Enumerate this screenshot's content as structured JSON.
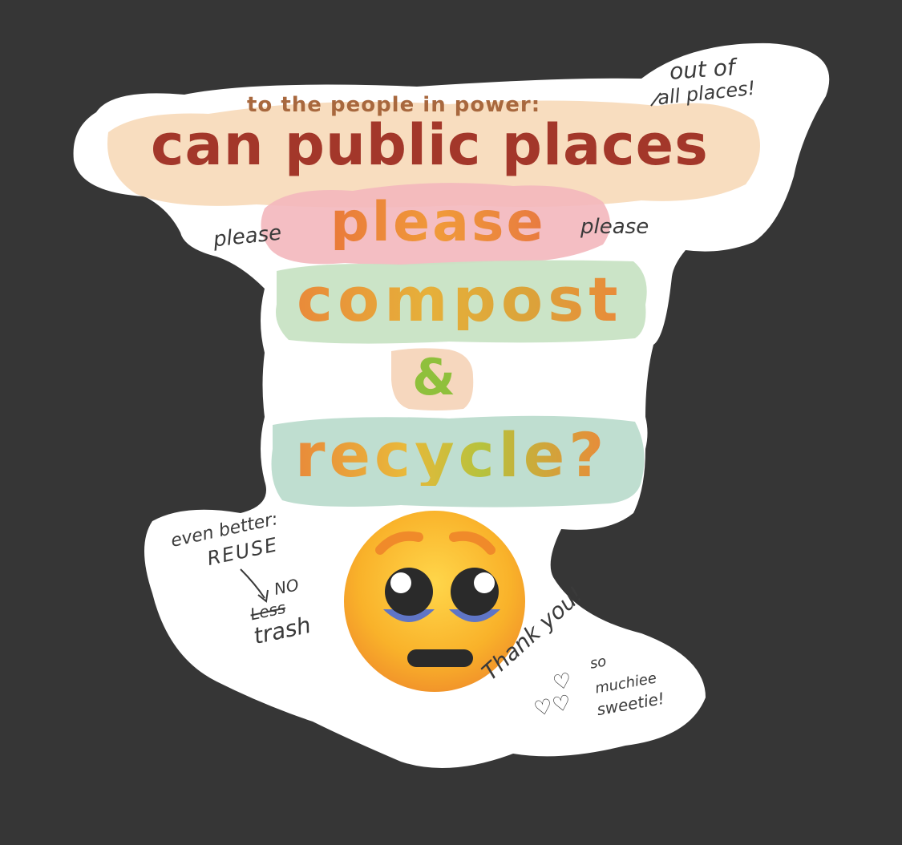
{
  "sticker": {
    "salutation": "to the people in power:",
    "headline": "can public places",
    "plea": "please",
    "action_1": "compost",
    "conjunction": "&",
    "action_2": "recycle?",
    "emoji": "pleading-face-emoji"
  },
  "notes": {
    "out_of_line1": "out of",
    "out_of_line2": "all places!",
    "please_left": "please",
    "please_right": "please",
    "even_better": "even better:",
    "reuse": "REUSE",
    "no": "NO",
    "less_struck": "Less",
    "trash": "trash",
    "thank_you": "Thank you!",
    "so": "so",
    "muchiee": "muchiee",
    "sweetie": "sweetie!"
  },
  "colors": {
    "background": "#363636",
    "sticker_border": "#ffffff",
    "headline": "#a3372a",
    "salutation": "#a8683e",
    "peach_wash": "#f7d9b8",
    "pink_wash": "#f3b7bc",
    "green_wash": "#c8e3c4",
    "teal_wash": "#bcdccd",
    "handwriting": "#3a3a3a"
  }
}
